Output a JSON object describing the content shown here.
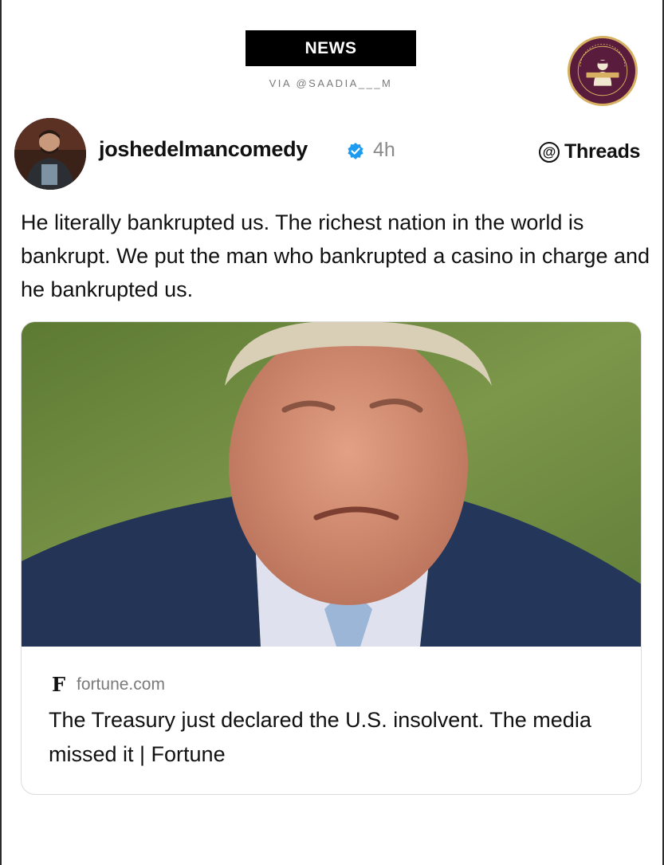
{
  "header": {
    "banner_label": "NEWS",
    "via_label": "VIA @SAADIA___M",
    "logo_icon": "satire-circle-logo"
  },
  "post": {
    "author": "joshedelmancomedy",
    "verified_icon": "verified-badge-icon",
    "timestamp": "4h",
    "platform": "Threads",
    "platform_icon": "threads-at-icon",
    "text": "He literally bankrupted us. The richest nation in the world is bankrupt. We put the man who bankrupted a casino in charge and he bankrupted us."
  },
  "link_card": {
    "source_icon": "fortune-f-icon",
    "source_icon_glyph": "F",
    "domain": "fortune.com",
    "title": "The Treasury just declared the U.S. insolvent. The media missed it | Fortune"
  },
  "colors": {
    "banner_bg": "#000000",
    "logo_bg": "#5a1c3c",
    "logo_border": "#d7b061",
    "verified_blue": "#1d9bf0",
    "muted_text": "#7a7a7a"
  }
}
